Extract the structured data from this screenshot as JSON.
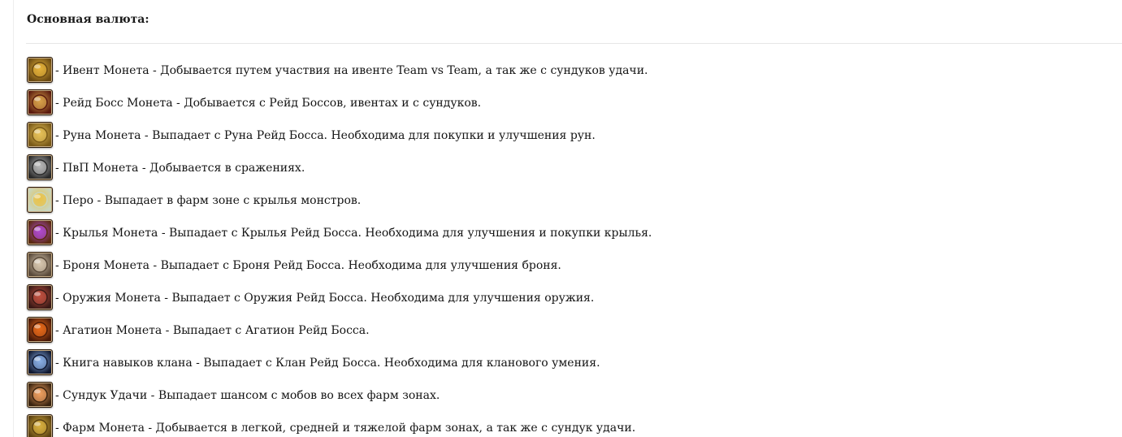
{
  "heading": "Основная валюта:",
  "items": [
    {
      "icon": "event-coin-icon",
      "text": "- Ивент Монета - Добывается путем участвия на ивенте Team vs Team, а так же с сундуков удачи.",
      "bg": "#6b4a12",
      "accent": "#e6b33a"
    },
    {
      "icon": "raid-boss-coin-icon",
      "text": "- Рейд Босс Монета - Добывается с Рейд Боссов, ивентах и с сундуков.",
      "bg": "#5a1a0e",
      "accent": "#d9a24a"
    },
    {
      "icon": "rune-coin-icon",
      "text": "- Руна Монета - Выпадает с Руна Рейд Босса. Необходима для покупки и улучшения рун.",
      "bg": "#7a5a18",
      "accent": "#e8c25a"
    },
    {
      "icon": "pvp-coin-icon",
      "text": "- ПвП Монета - Добывается в сражениях.",
      "bg": "#2a2a2a",
      "accent": "#b8b8b8"
    },
    {
      "icon": "feather-icon",
      "text": "- Перо - Выпадает в фарм зоне с крылья монстров.",
      "bg": "#c8d6c0",
      "accent": "#e9c24a"
    },
    {
      "icon": "wings-coin-icon",
      "text": "- Крылья Монета - Выпадает с Крылья Рейд Босса. Необходима для улучшения и покупки крылья.",
      "bg": "#5a2a10",
      "accent": "#b04ad0"
    },
    {
      "icon": "armor-coin-icon",
      "text": "- Броня Монета - Выпадает с Броня Рейд Босса. Необходима для улучшения броня.",
      "bg": "#5a4a3a",
      "accent": "#d8c8b0"
    },
    {
      "icon": "weapon-coin-icon",
      "text": "- Оружия Монета - Выпадает с Оружия Рейд Босса. Необходима для улучшения оружия.",
      "bg": "#3a1a16",
      "accent": "#c05040"
    },
    {
      "icon": "agathion-coin-icon",
      "text": "- Агатион Монета - Выпадает с Агатион Рейд Босса.",
      "bg": "#4a1a08",
      "accent": "#e86a1a"
    },
    {
      "icon": "clan-skill-book-icon",
      "text": "- Книга навыков клана - Выпадает с Клан Рейд Босса. Необходима для кланового умения.",
      "bg": "#101830",
      "accent": "#8ab0e8"
    },
    {
      "icon": "luck-chest-icon",
      "text": "- Сундук Удачи - Выпадает шансом с мобов во всех фарм зонах.",
      "bg": "#3a2410",
      "accent": "#f0a060"
    },
    {
      "icon": "farm-coin-icon",
      "text": "- Фарм Монета - Добывается в легкой, средней и тяжелой фарм зонах, а так же с сундук удачи.",
      "bg": "#5a4010",
      "accent": "#d8b040"
    }
  ]
}
